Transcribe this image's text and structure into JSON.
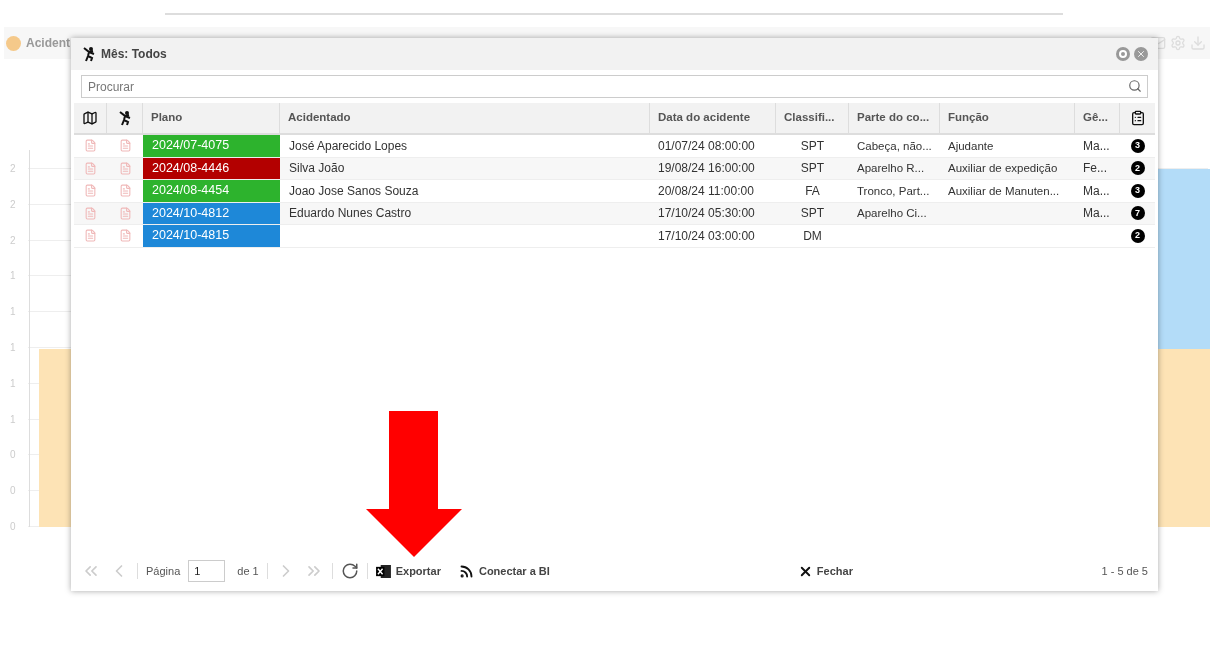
{
  "background": {
    "panel_title": "Acident",
    "y_ticks": [
      "2",
      "2",
      "2",
      "1",
      "1",
      "1",
      "1",
      "1",
      "0",
      "0",
      "0"
    ]
  },
  "dialog": {
    "title": "Mês: Todos",
    "search": {
      "placeholder": "Procurar"
    },
    "columns": [
      "Plano",
      "Acidentado",
      "Data do acidente",
      "Classifi...",
      "Parte do co...",
      "Função",
      "Gê..."
    ],
    "rows": [
      {
        "plano": "2024/07-4075",
        "color": "#2db32d",
        "acidentado": "José Aparecido Lopes",
        "data": "01/07/24 08:00:00",
        "classificacao": "SPT",
        "parte": "Cabeça, não...",
        "funcao": "Ajudante",
        "genero": "Ma...",
        "count": "3"
      },
      {
        "plano": "2024/08-4446",
        "color": "#b30000",
        "acidentado": "Silva João",
        "data": "19/08/24 16:00:00",
        "classificacao": "SPT",
        "parte": "Aparelho R...",
        "funcao": "Auxiliar de expedição",
        "genero": "Fe...",
        "count": "2"
      },
      {
        "plano": "2024/08-4454",
        "color": "#2db32d",
        "acidentado": "Joao Jose Sanos Souza",
        "data": "20/08/24 11:00:00",
        "classificacao": "FA",
        "parte": "Tronco, Part...",
        "funcao": "Auxiliar de Manuten...",
        "genero": "Ma...",
        "count": "3"
      },
      {
        "plano": "2024/10-4812",
        "color": "#1e88d8",
        "acidentado": "Eduardo Nunes Castro",
        "data": "17/10/24 05:30:00",
        "classificacao": "SPT",
        "parte": "Aparelho Ci...",
        "funcao": "",
        "genero": "Ma...",
        "count": "7"
      },
      {
        "plano": "2024/10-4815",
        "color": "#1e88d8",
        "acidentado": "",
        "data": "17/10/24 03:00:00",
        "classificacao": "DM",
        "parte": "",
        "funcao": "",
        "genero": "",
        "count": "2"
      }
    ],
    "footer": {
      "page_label": "Página",
      "page": "1",
      "page_total": "de 1",
      "export": "Exportar",
      "connect": "Conectar a BI",
      "close": "Fechar",
      "range": "1 - 5 de 5"
    }
  }
}
